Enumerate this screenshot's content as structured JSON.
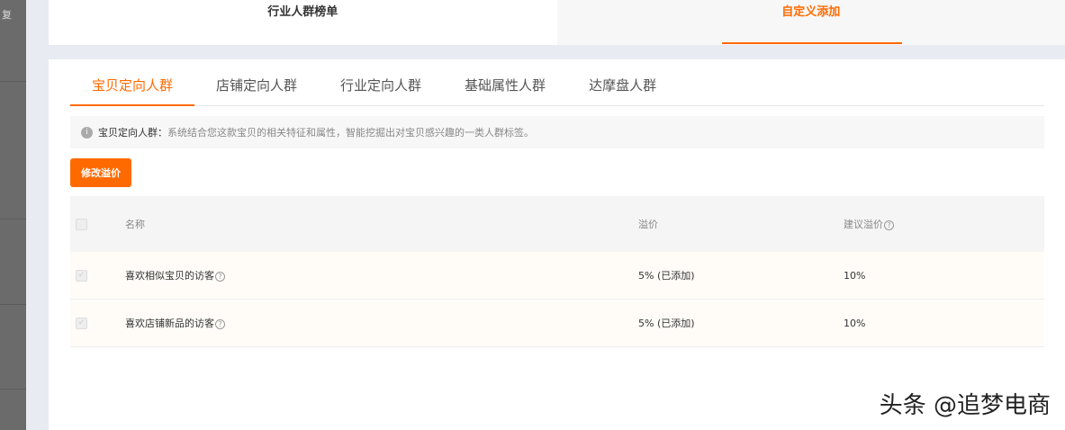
{
  "sidebar": {
    "copy_label": "复"
  },
  "top_tabs": [
    {
      "label": "行业人群榜单"
    },
    {
      "label": "自定义添加"
    }
  ],
  "tabs": [
    {
      "label": "宝贝定向人群"
    },
    {
      "label": "店铺定向人群"
    },
    {
      "label": "行业定向人群"
    },
    {
      "label": "基础属性人群"
    },
    {
      "label": "达摩盘人群"
    }
  ],
  "tip": {
    "title": "宝贝定向人群：",
    "text": "系统结合您这款宝贝的相关特征和属性，智能挖掘出对宝贝感兴趣的一类人群标签。"
  },
  "modify_button": "修改溢价",
  "table": {
    "headers": {
      "name": "名称",
      "premium": "溢价",
      "suggest": "建议溢价"
    },
    "rows": [
      {
        "name": "喜欢相似宝贝的访客",
        "premium": "5% (已添加)",
        "suggest": "10%"
      },
      {
        "name": "喜欢店铺新品的访客",
        "premium": "5% (已添加)",
        "suggest": "10%"
      }
    ]
  },
  "watermark": "头条 @追梦电商",
  "colors": {
    "accent": "#ff6a00"
  }
}
